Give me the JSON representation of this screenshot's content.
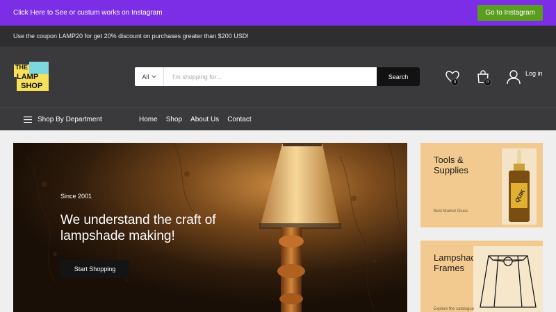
{
  "topbar": {
    "text": "Click Here to See or custum works on Instagram",
    "button": "Go to Instagram"
  },
  "coupon": {
    "text": "Use the coupon LAMP20 for get 20% discount on purchases greater than $200 USD!"
  },
  "logo": {
    "line1": "THE",
    "line2": "LAMP",
    "line3": "SHOP"
  },
  "search": {
    "category": "All",
    "placeholder": "I'm shopping for...",
    "button": "Search"
  },
  "header": {
    "wishlist_count": "0",
    "cart_count": "0",
    "login": "Log in"
  },
  "nav": {
    "department": "Shop By Department",
    "links": [
      "Home",
      "Shop",
      "About Us",
      "Contact"
    ]
  },
  "hero": {
    "since": "Since 2001",
    "headline": "We understand the craft of lampshade making!",
    "cta": "Start Shopping"
  },
  "cards": [
    {
      "title": "Tools & Supplies",
      "subtitle": "Best Market Glues"
    },
    {
      "title": "Lampshade Frames",
      "subtitle": "Explore the catalogue"
    }
  ]
}
